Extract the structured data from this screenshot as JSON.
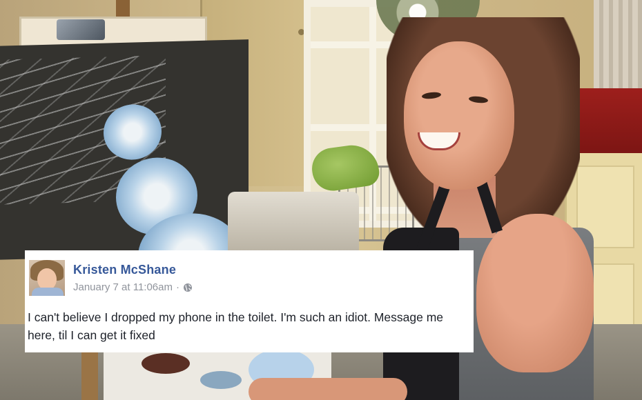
{
  "post": {
    "author": "Kristen McShane",
    "timestamp": "January 7 at 11:06am",
    "separator": "·",
    "privacy_icon": "globe-icon",
    "text": "I can't believe I dropped my phone in the toilet. I'm such an idiot. Message me here, til I can get it fixed"
  },
  "colors": {
    "author_link": "#365899",
    "meta_text": "#90949c",
    "body_text": "#1d2129",
    "card_background": "#ffffff"
  }
}
